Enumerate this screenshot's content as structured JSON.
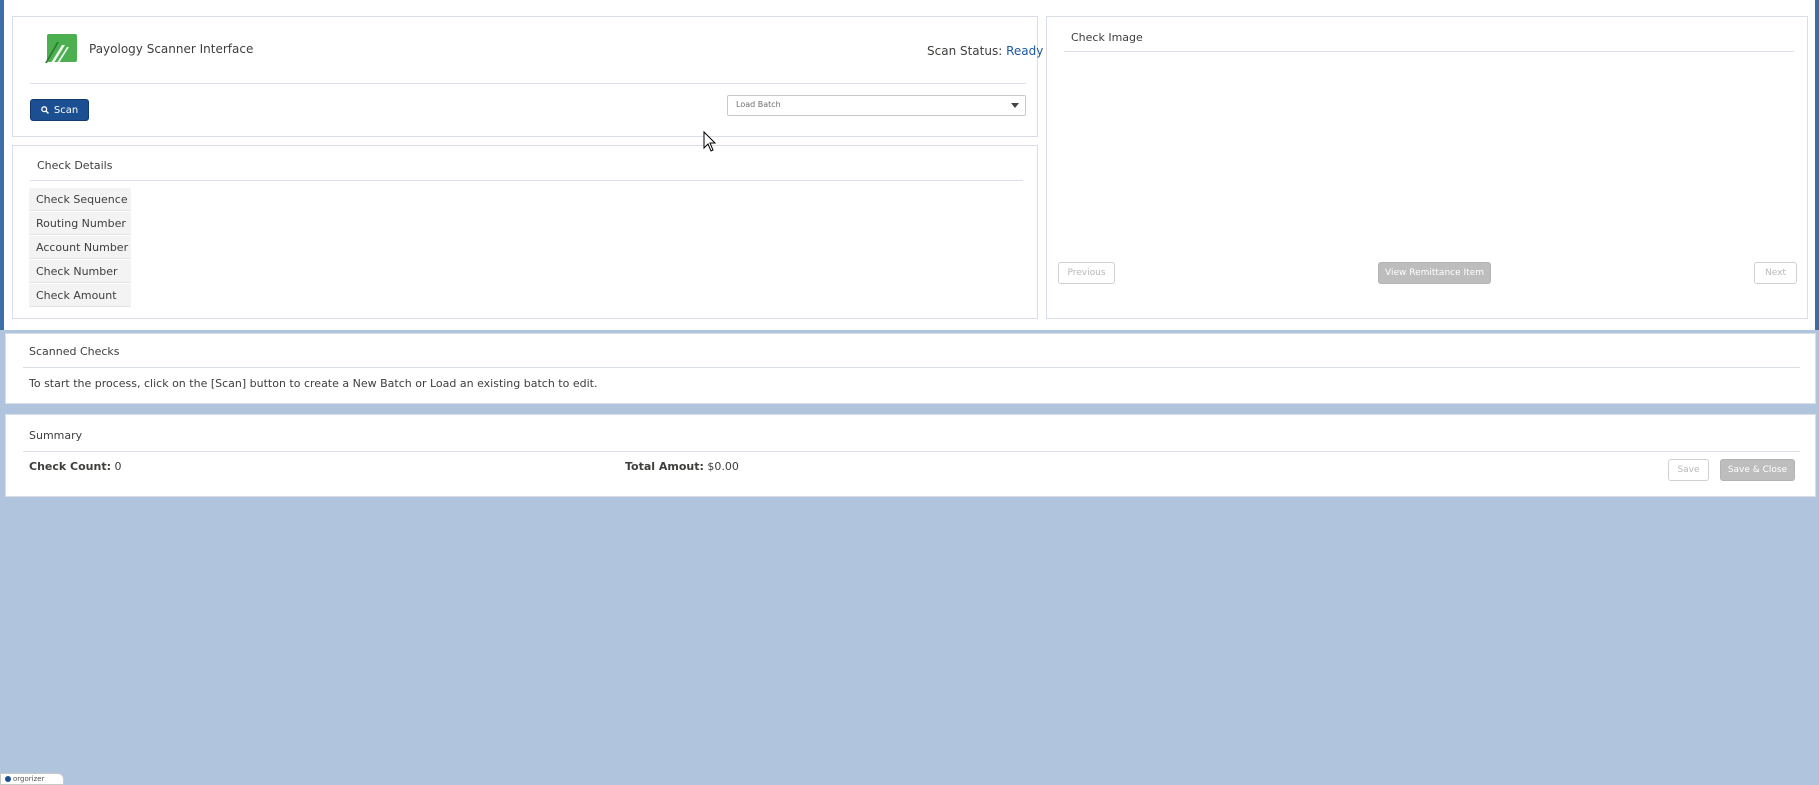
{
  "header": {
    "app_title": "Payology Scanner Interface",
    "status_label": "Scan Status:",
    "status_value": "Ready",
    "scan_button_label": "Scan",
    "scan_icon": "search-icon",
    "load_batch_placeholder": "Load Batch"
  },
  "check_details": {
    "title": "Check Details",
    "rows": [
      {
        "label": "Check Sequence"
      },
      {
        "label": "Routing Number"
      },
      {
        "label": "Account Number"
      },
      {
        "label": "Check Number"
      },
      {
        "label": "Check Amount"
      }
    ]
  },
  "check_image": {
    "title": "Check Image",
    "previous_label": "Previous",
    "view_remittance_label": "View Remittance Item",
    "next_label": "Next"
  },
  "scanned_checks": {
    "title": "Scanned Checks",
    "message": "To start the process, click on the [Scan] button to create a New Batch or Load an existing batch to edit."
  },
  "summary": {
    "title": "Summary",
    "check_count_label": "Check Count:",
    "check_count_value": "0",
    "total_label": "Total Amout:",
    "total_value": "$0.00",
    "save_label": "Save",
    "save_close_label": "Save & Close"
  },
  "footer": {
    "badge_text": "orgorizer"
  },
  "colors": {
    "page_background": "#b0c4de",
    "primary_button": "#1b4f92",
    "status_ready": "#1c5aa0",
    "logo_green": "#4caf50"
  }
}
